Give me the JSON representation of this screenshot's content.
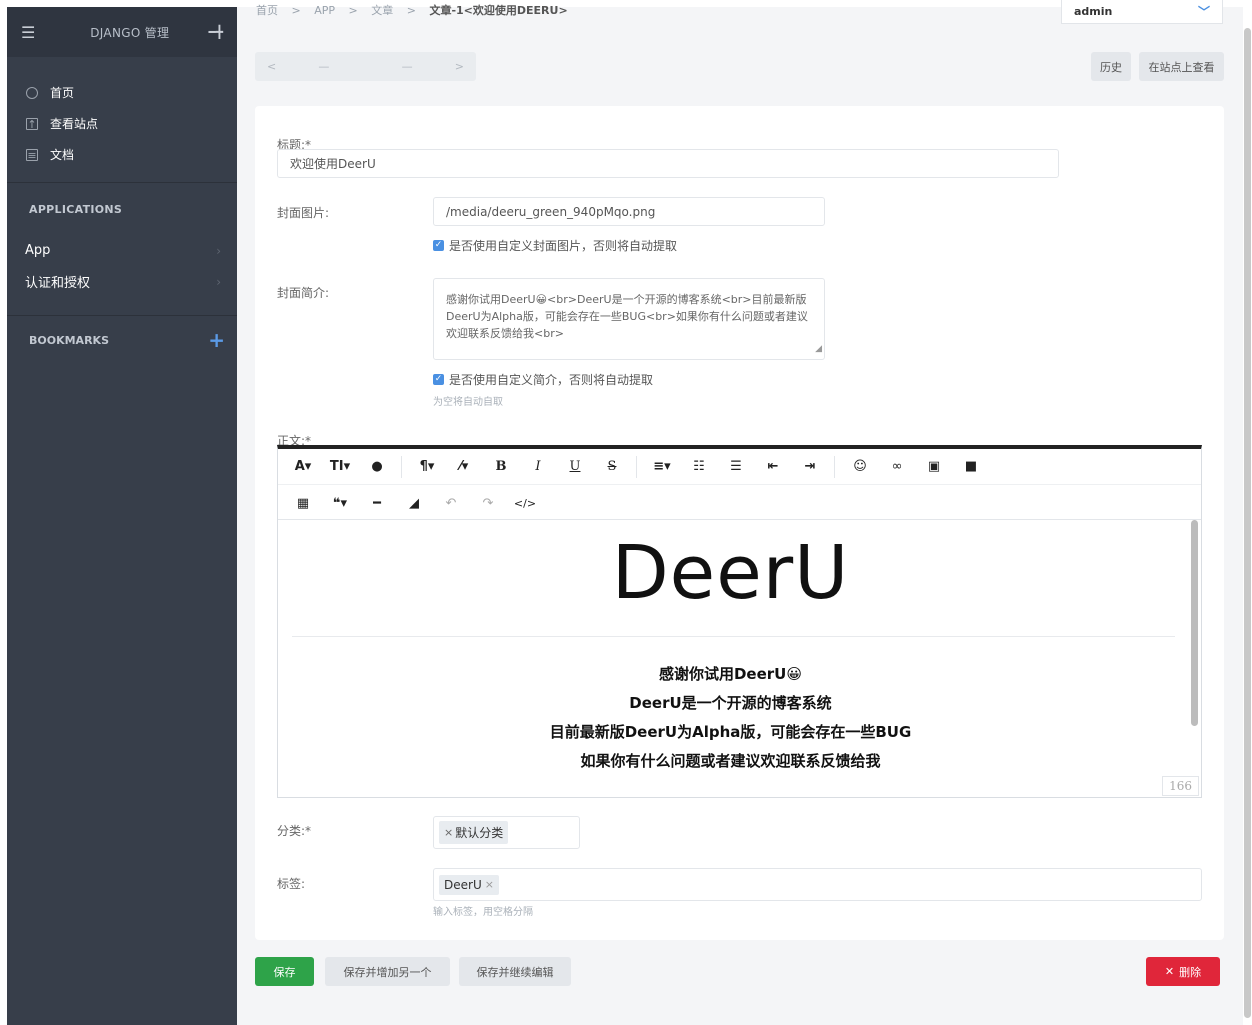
{
  "sidebar": {
    "title": "DJANGO 管理",
    "links": [
      {
        "label": "首页",
        "icon": "circle-icon"
      },
      {
        "label": "查看站点",
        "icon": "site-icon"
      },
      {
        "label": "文档",
        "icon": "doc-icon"
      }
    ],
    "applications_header": "APPLICATIONS",
    "apps": [
      {
        "label": "App"
      },
      {
        "label": "认证和授权"
      }
    ],
    "bookmarks_header": "BOOKMARKS"
  },
  "breadcrumb": {
    "items": [
      "首页",
      "APP",
      "文章"
    ],
    "current": "文章-1<欢迎使用DEERU>",
    "separator": ">"
  },
  "user": {
    "name": "admin"
  },
  "pager": {
    "prev": "<",
    "left_placeholder": "—",
    "right_placeholder": "—",
    "next": ">"
  },
  "top_buttons": {
    "history": "历史",
    "view_on_site": "在站点上查看"
  },
  "form": {
    "title_label": "标题:*",
    "title_value": "欢迎使用DeerU",
    "cover_label": "封面图片:",
    "cover_value": "/media/deeru_green_940pMqo.png",
    "cover_checkbox": "是否使用自定义封面图片，否则将自动提取",
    "summary_label": "封面简介:",
    "summary_value": "感谢你试用DeerU😀<br>DeerU是一个开源的博客系统<br>目前最新版DeerU为Alpha版，可能会存在一些BUG<br>如果你有什么问题或者建议欢迎联系反馈给我<br>",
    "summary_checkbox": "是否使用自定义简介，否则将自动提取",
    "summary_help": "为空将自动自取",
    "body_label": "正文:*",
    "category_label": "分类:*",
    "category_tag": "默认分类",
    "tags_label": "标签:",
    "tag_value": "DeerU",
    "tags_help": "输入标签，用空格分隔"
  },
  "editor": {
    "logo_text": "DeerU",
    "lines": [
      "感谢你试用DeerU😀",
      "DeerU是一个开源的博客系统",
      "目前最新版DeerU为Alpha版，可能会存在一些BUG",
      "如果你有什么问题或者建议欢迎联系反馈给我"
    ],
    "char_count": "166"
  },
  "footer": {
    "save": "保存",
    "save_add_another": "保存并增加另一个",
    "save_continue": "保存并继续编辑",
    "delete": "删除"
  },
  "colors": {
    "sidebar_bg": "#373e4a",
    "save_green": "#2ea349",
    "delete_red": "#e0263a",
    "accent_blue": "#4a90e2"
  }
}
